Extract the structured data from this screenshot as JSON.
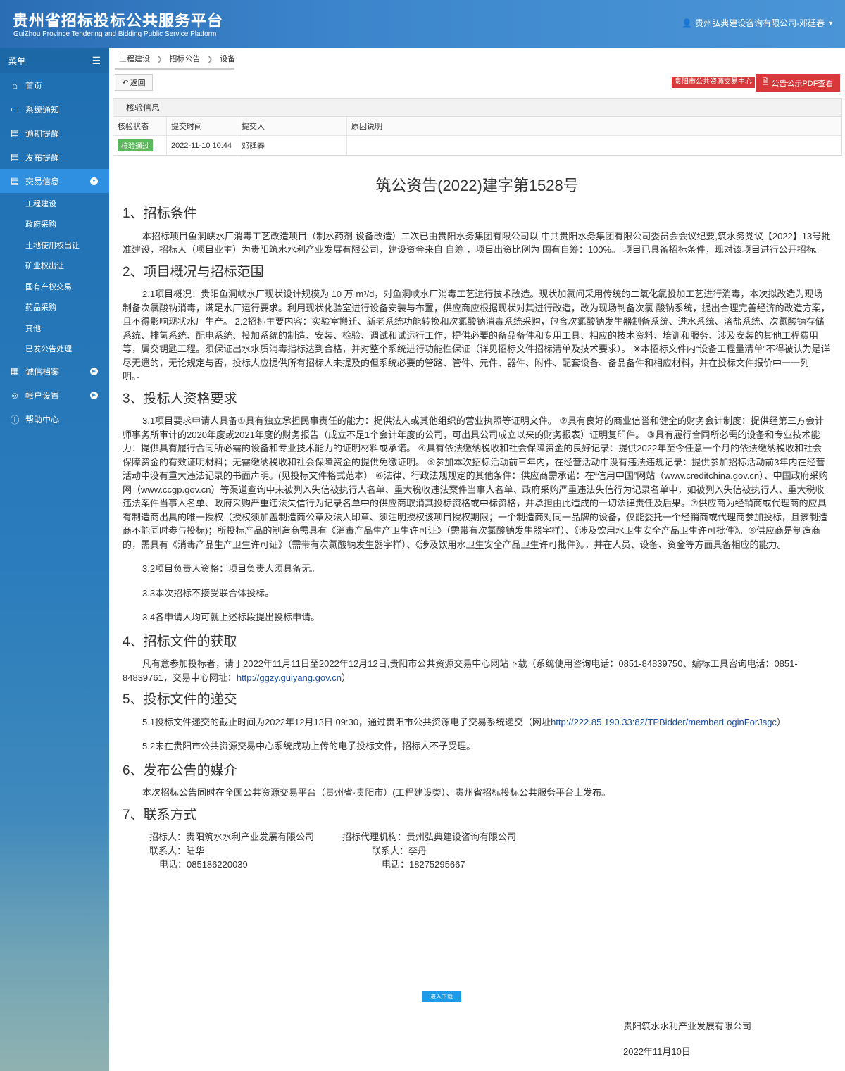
{
  "header": {
    "title_cn": "贵州省招标投标公共服务平台",
    "title_en": "GuiZhou Province Tendering and Bidding Public Service Platform",
    "user": "贵州弘典建设咨询有限公司-邓廷春"
  },
  "sidebar": {
    "menu_label": "菜单",
    "items": [
      {
        "label": "首页",
        "icon": "home-icon"
      },
      {
        "label": "系统通知",
        "icon": "monitor-icon"
      },
      {
        "label": "逾期提醒",
        "icon": "list-icon"
      },
      {
        "label": "发布提醒",
        "icon": "list-icon"
      },
      {
        "label": "交易信息",
        "icon": "list-icon"
      },
      {
        "label": "诚信档案",
        "icon": "grid-icon"
      },
      {
        "label": "帐户设置",
        "icon": "user-icon"
      },
      {
        "label": "帮助中心",
        "icon": "help-icon"
      }
    ],
    "sub_items": [
      "工程建设",
      "政府采购",
      "土地使用权出让",
      "矿业权出让",
      "国有产权交易",
      "药品采购",
      "其他",
      "已发公告处理"
    ]
  },
  "breadcrumb": [
    "工程建设",
    "招标公告",
    "设备"
  ],
  "toolbar": {
    "back_label": "返回",
    "center_tag": "贵阳市公共资源交易中心",
    "pdf_label": "公告公示PDF查看"
  },
  "verify": {
    "title": "核验信息",
    "headers": [
      "核验状态",
      "提交时间",
      "提交人",
      "原因说明"
    ],
    "row": {
      "status": "核验通过",
      "time": "2022-11-10 10:44",
      "submitter": "邓廷春",
      "reason": ""
    }
  },
  "doc": {
    "title": "筑公资告(2022)建字第1528号",
    "s1_title": "1、招标条件",
    "s1_p": "本招标项目鱼洞峡水厂消毒工艺改造项目（制水药剂 设备改造）二次已由贵阳水务集团有限公司以 中共贵阳水务集团有限公司委员会会议纪要,筑水务党议【2022】13号批准建设，招标人（项目业主）为贵阳筑水水利产业发展有限公司，建设资金来自 自筹 ，项目出资比例为 国有自筹：100%。 项目已具备招标条件，现对该项目进行公开招标。",
    "s2_title": "2、项目概况与招标范围",
    "s2_p": "2.1项目概况：贵阳鱼洞峡水厂现状设计规模为 10 万 m³/d，对鱼洞峡水厂消毒工艺进行技术改造。现状加氯间采用传统的二氧化氯投加工艺进行消毒，本次拟改造为现场制备次氯酸钠消毒，满足水厂运行要求。利用现状化验室进行设备安装与布置，供应商应根据现状对其进行改造，改为现场制备次氯 酸钠系统，提出合理完善经济的改造方案，且不得影响现状水厂生产。 2.2招标主要内容：实验室搬迁、新老系统功能转换和次氯酸钠消毒系统采购，包含次氯酸钠发生器制备系统、进水系统、溶盐系统、次氯酸钠存储系统、排氢系统、配电系统、投加系统的制造、安装、检验、调试和试运行工作，提供必要的备品备件和专用工具、相应的技术资料、培训和服务、涉及安装的其他工程费用等，属交钥匙工程。须保证出水水质消毒指标达到合格，并对整个系统进行功能性保证（详见招标文件招标清单及技术要求）。 ※本招标文件内“设备工程量清单”不得被认为是详尽无遗的，无论规定与否，投标人应提供所有招标人未提及的但系统必要的管路、管件、元件、器件、附件、配套设备、备品备件和相应材料，并在投标文件报价中一一列明。。",
    "s3_title": "3、投标人资格要求",
    "s3_p1": "3.1项目要求申请人具备①具有独立承担民事责任的能力：提供法人或其他组织的营业执照等证明文件。 ②具有良好的商业信誉和健全的财务会计制度：提供经第三方会计师事务所审计的2020年度或2021年度的财务报告（成立不足1个会计年度的公司，可出具公司成立以来的财务报表）证明复印件。 ③具有履行合同所必需的设备和专业技术能力：提供具有履行合同所必需的设备和专业技术能力的证明材料或承诺。 ④具有依法缴纳税收和社会保障资金的良好记录：提供2022年至今任意一个月的依法缴纳税收和社会保障资金的有效证明材料；无需缴纳税收和社会保障资金的提供免缴证明。 ⑤参加本次招标活动前三年内，在经营活动中没有违法违规记录：提供参加招标活动前3年内在经营活动中没有重大违法记录的书面声明。(见投标文件格式范本） ⑥法律、行政法规规定的其他条件：供应商需承诺：在“信用中国”网站（www.creditchina.gov.cn）、中国政府采购网（www.ccgp.gov.cn）等渠道查询中未被列入失信被执行人名单、重大税收违法案件当事人名单、政府采购严重违法失信行为记录名单中，如被列入失信被执行人、重大税收违法案件当事人名单、政府采购严重违法失信行为记录名单中的供应商取消其投标资格或中标资格，并承担由此造成的一切法律责任及后果。⑦供应商为经销商或代理商的应具有制造商出具的唯一授权（授权须加盖制造商公章及法人印章、须注明授权该项目授权期限；一个制造商对同一品牌的设备，仅能委托一个经销商或代理商参加投标，且该制造商不能同时参与投标)；所投标产品的制造商需具有《消毒产品生产卫生许可证》（需带有次氯酸钠发生器字样）、《涉及饮用水卫生安全产品卫生许可批件》。⑧供应商是制造商的，需具有《消毒产品生产卫生许可证》（需带有次氯酸钠发生器字样）、《涉及饮用水卫生安全产品卫生许可批件》。，并在人员、设备、资金等方面具备相应的能力。",
    "s3_p2": "3.2项目负责人资格：项目负责人须具备无。",
    "s3_p3": "3.3本次招标不接受联合体投标。",
    "s3_p4": "3.4各申请人均可就上述标段提出投标申请。",
    "s4_title": "4、招标文件的获取",
    "s4_p_pre": "凡有意参加投标者，请于2022年11月11日至2022年12月12日,贵阳市公共资源交易中心网站下载（系统使用咨询电话：0851-84839750、编标工具咨询电话：0851-84839761，交易中心网址：",
    "s4_link": "http://ggzy.guiyang.gov.cn",
    "s4_p_post": "）",
    "s5_title": "5、投标文件的递交",
    "s5_p1_pre": "5.1投标文件递交的截止时间为2022年12月13日 09:30，通过贵阳市公共资源电子交易系统递交（网址",
    "s5_link": "http://222.85.190.33:82/TPBidder/memberLoginForJsgc",
    "s5_p1_post": "）",
    "s5_p2": "5.2未在贵阳市公共资源交易中心系统成功上传的电子投标文件，招标人不予受理。",
    "s6_title": "6、发布公告的媒介",
    "s6_p": "本次招标公告同时在全国公共资源交易平台（贵州省·贵阳市）(工程建设类）、贵州省招标投标公共服务平台上发布。",
    "s7_title": "7、联系方式",
    "contact": {
      "tenderer": "招标人：贵阳筑水水利产业发展有限公司",
      "agent": "招标代理机构：贵州弘典建设咨询有限公司",
      "contact1": "联系人：陆华",
      "contact2": "联系人：李丹",
      "phone1": "电话：085186220039",
      "phone2": "电话：18275295667"
    },
    "download_label": "进入下载",
    "sign_company": "贵阳筑水水利产业发展有限公司",
    "sign_date": "2022年11月10日"
  }
}
